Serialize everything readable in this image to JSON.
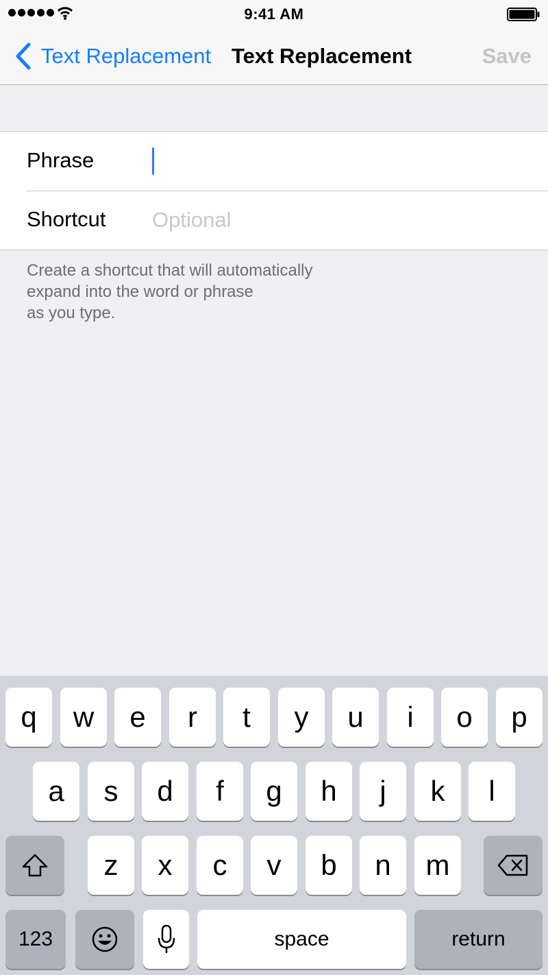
{
  "status_bar": {
    "time": "9:41 AM",
    "icons": [
      "signal-dots-icon",
      "wifi-icon",
      "battery-icon"
    ]
  },
  "nav": {
    "back_label": "Text Replacement",
    "title": "Text Replacement",
    "save_label": "Save"
  },
  "form": {
    "phrase_label": "Phrase",
    "phrase_value": "",
    "shortcut_label": "Shortcut",
    "shortcut_placeholder": "Optional",
    "footer": "Create a shortcut that will automatically\n expand into the word or phrase\n as you type."
  },
  "keyboard": {
    "row1": [
      "q",
      "w",
      "e",
      "r",
      "t",
      "y",
      "u",
      "i",
      "o",
      "p"
    ],
    "row2": [
      "a",
      "s",
      "d",
      "f",
      "g",
      "h",
      "j",
      "k",
      "l"
    ],
    "row3": [
      "z",
      "x",
      "c",
      "v",
      "b",
      "n",
      "m"
    ],
    "numbers_label": "123",
    "space_label": "space",
    "return_label": "return",
    "icons": [
      "shift-icon",
      "backspace-icon",
      "emoji-icon",
      "microphone-icon"
    ]
  },
  "colors": {
    "accent": "#147efb",
    "caret": "#3478f6",
    "disabled": "#c4c4c8",
    "background": "#efeff4",
    "keyboard": "#d1d5db"
  }
}
